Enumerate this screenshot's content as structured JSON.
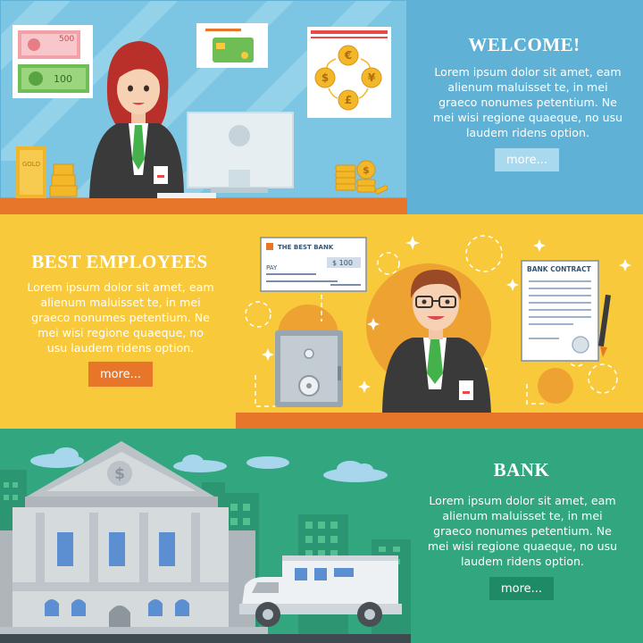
{
  "banners": {
    "welcome": {
      "title": "WELCOME!",
      "body": "Lorem ipsum dolor sit amet, eam alienum maluisset te, in mei graeco nonumes petentium. Ne mei wisi regione quaeque, no usu laudem ridens option.",
      "button": "more...",
      "illustration": {
        "banknote_values": [
          "500",
          "100"
        ],
        "gold_bar_label": "GOLD",
        "currency_symbols": [
          "€",
          "$",
          "¥",
          "£"
        ],
        "coin_symbol": "$"
      }
    },
    "employees": {
      "title": "BEST EMPLOYEES",
      "body": "Lorem ipsum dolor sit amet, eam alienum maluisset te, in mei graeco nonumes petentium. Ne mei wisi regione quaeque, no usu laudem ridens option.",
      "button": "more...",
      "illustration": {
        "check_bank": "THE BEST BANK",
        "check_pay": "PAY",
        "check_amount": "$ 100",
        "contract_title": "BANK CONTRACT"
      }
    },
    "bank": {
      "title": "BANK",
      "body": "Lorem ipsum dolor sit amet, eam alienum maluisset te, in mei graeco nonumes petentium. Ne mei wisi regione quaeque, no usu laudem ridens option.",
      "button": "more...",
      "illustration": {
        "pediment_symbol": "$"
      }
    }
  },
  "colors": {
    "welcome_bg": "#5fb2d6",
    "employees_bg": "#f8c93b",
    "bank_bg": "#32a67f",
    "accent_orange": "#e8762a",
    "suit": "#3a3a3a",
    "tie_green": "#44b24a"
  },
  "icons": [
    "banknote-icon",
    "credit-card-icon",
    "currency-exchange-icon",
    "gold-bar-icon",
    "coin-stack-icon",
    "computer-monitor-icon",
    "check-icon",
    "safe-icon",
    "contract-icon",
    "pen-icon",
    "bank-building-icon",
    "armored-truck-icon",
    "cloud-icon",
    "sparkle-icon"
  ]
}
